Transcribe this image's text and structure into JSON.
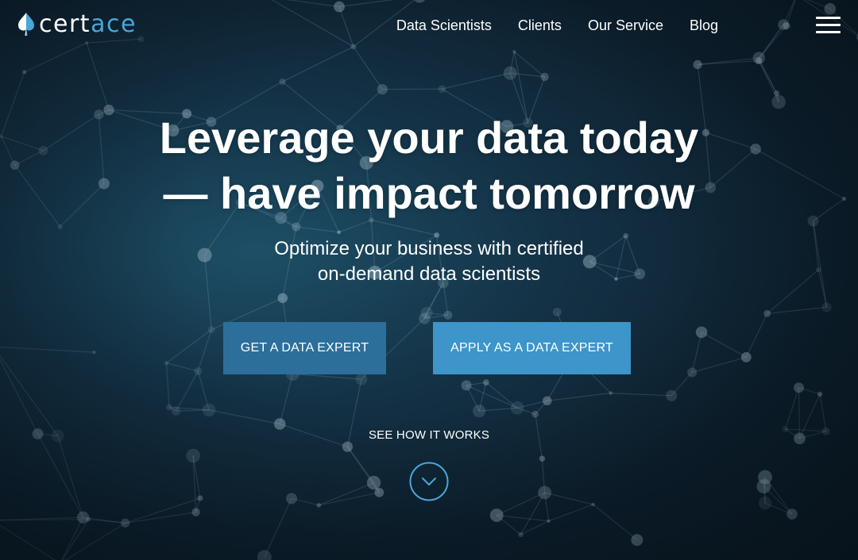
{
  "brand": {
    "name_part1": "cert",
    "name_part2": "ace",
    "accent_color": "#4aa6d8"
  },
  "nav": {
    "items": [
      {
        "label": "Data Scientists"
      },
      {
        "label": "Clients"
      },
      {
        "label": "Our Service"
      },
      {
        "label": "Blog"
      }
    ],
    "menu_icon": "hamburger-menu-icon"
  },
  "hero": {
    "headline_line1": "Leverage your data today",
    "headline_line2": "— have impact tomorrow",
    "subheadline_line1": "Optimize your business with certified",
    "subheadline_line2": "on-demand data scientists",
    "primary_cta": "GET A DATA EXPERT",
    "secondary_cta": "APPLY AS A DATA EXPERT",
    "how_it_works": "SEE HOW IT WORKS",
    "scroll_icon": "chevron-down-circle-icon"
  },
  "colors": {
    "background": "#0e2433",
    "primary_button": "#2c6f9a",
    "secondary_button": "#3d95c9",
    "text": "#ffffff"
  }
}
